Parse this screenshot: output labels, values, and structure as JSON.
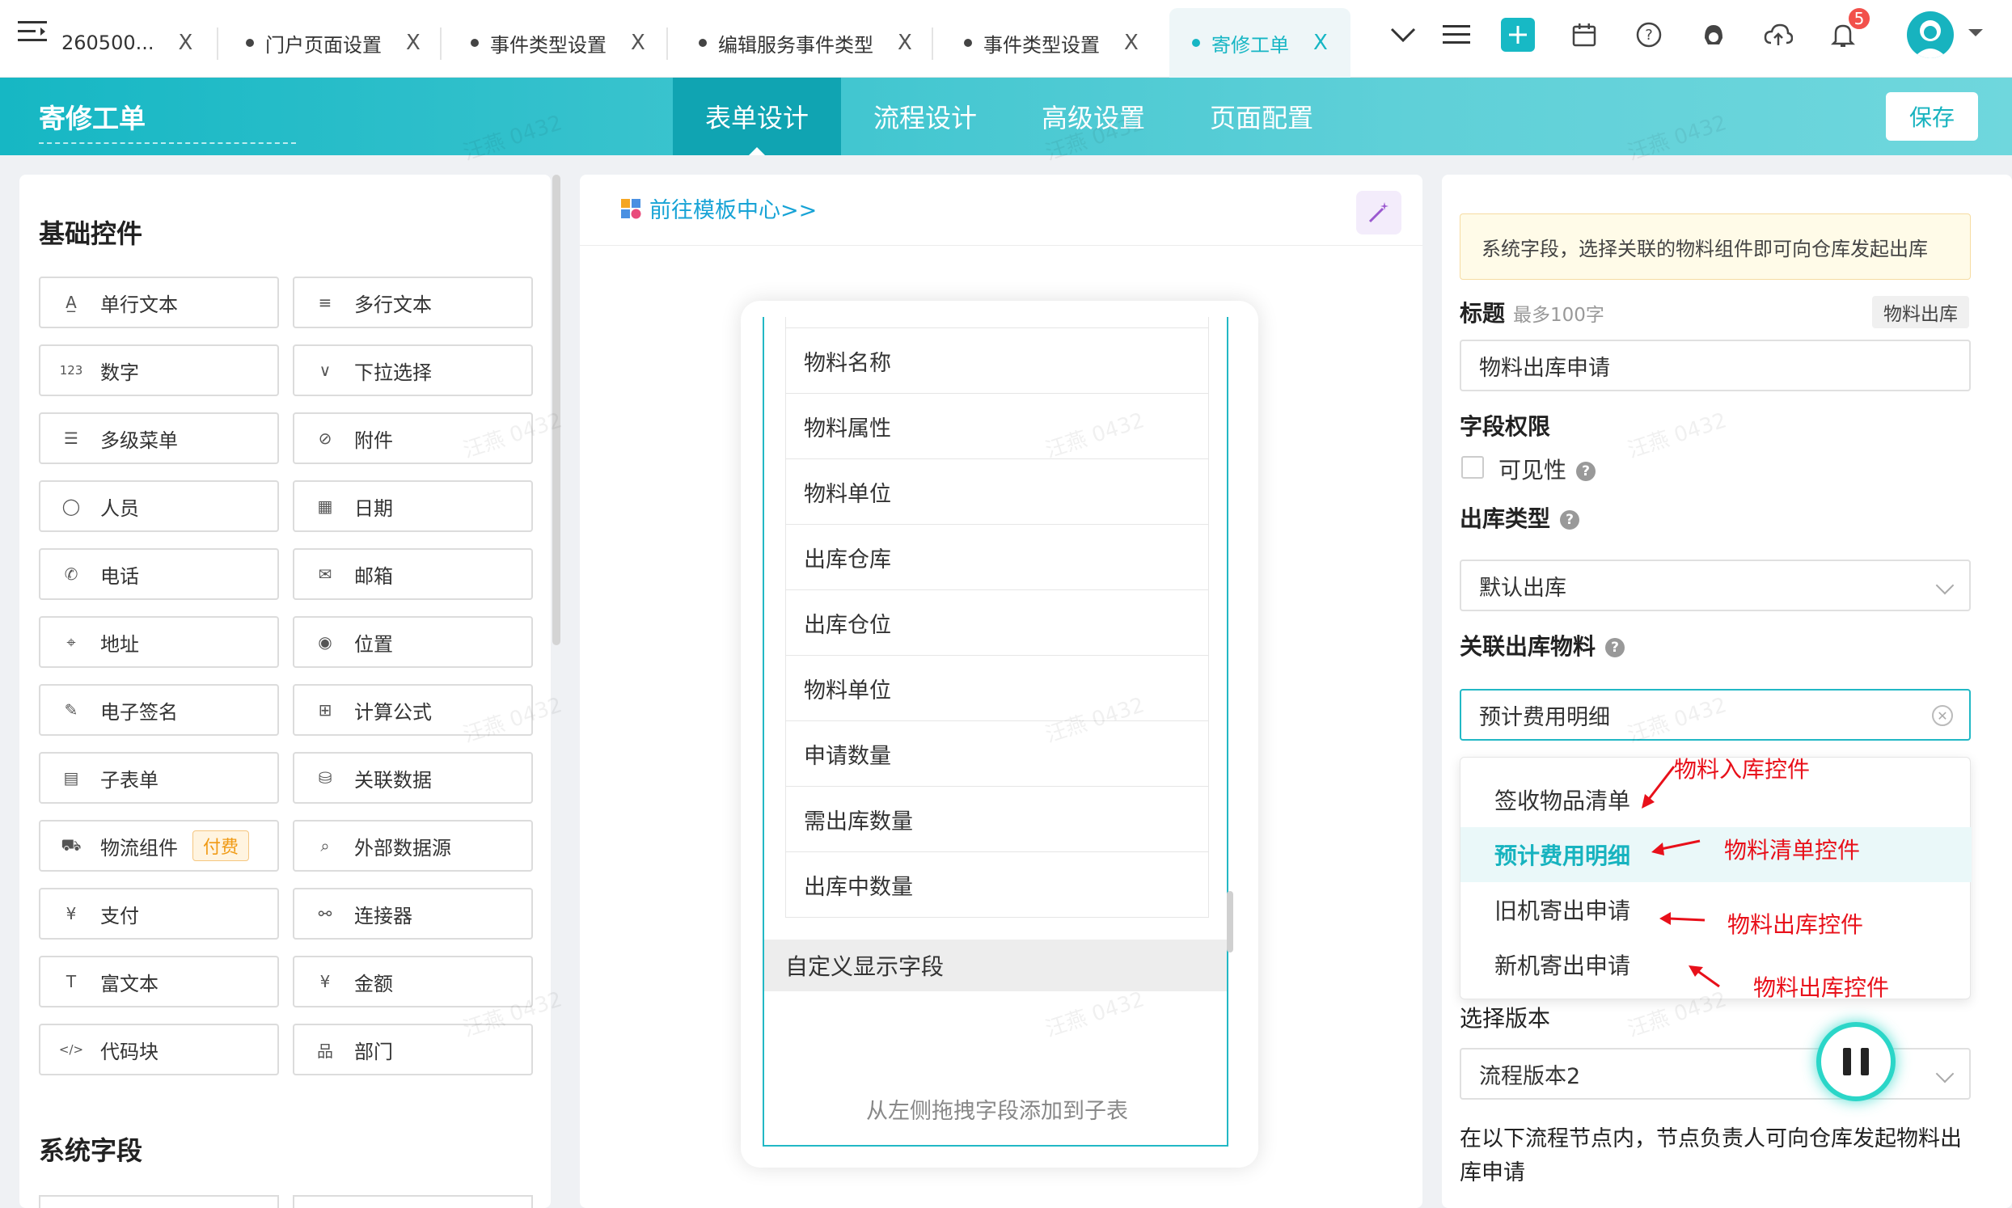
{
  "tabs": [
    {
      "label": "260500...",
      "x": "X"
    },
    {
      "label": "门户页面设置",
      "x": "X"
    },
    {
      "label": "事件类型设置",
      "x": "X"
    },
    {
      "label": "编辑服务事件类型",
      "x": "X"
    },
    {
      "label": "事件类型设置",
      "x": "X"
    },
    {
      "label": "寄修工单",
      "x": "X",
      "active": true
    }
  ],
  "topbar": {
    "notification_count": "5",
    "accent": "#17b9c5"
  },
  "header": {
    "form_title": "寄修工单",
    "tabs": [
      "表单设计",
      "流程设计",
      "高级设置",
      "页面配置"
    ],
    "active_tab": "表单设计",
    "save_label": "保存"
  },
  "left": {
    "basic_title": "基础控件",
    "controls": [
      {
        "label": "单行文本",
        "icon": "single-line-text-icon"
      },
      {
        "label": "多行文本",
        "icon": "multi-line-text-icon"
      },
      {
        "label": "数字",
        "icon": "number-icon"
      },
      {
        "label": "下拉选择",
        "icon": "dropdown-icon"
      },
      {
        "label": "多级菜单",
        "icon": "list-icon"
      },
      {
        "label": "附件",
        "icon": "paperclip-icon"
      },
      {
        "label": "人员",
        "icon": "user-icon"
      },
      {
        "label": "日期",
        "icon": "calendar-icon"
      },
      {
        "label": "电话",
        "icon": "phone-icon"
      },
      {
        "label": "邮箱",
        "icon": "mail-icon"
      },
      {
        "label": "地址",
        "icon": "map-icon"
      },
      {
        "label": "位置",
        "icon": "location-pin-icon"
      },
      {
        "label": "电子签名",
        "icon": "signature-icon"
      },
      {
        "label": "计算公式",
        "icon": "calculator-icon"
      },
      {
        "label": "子表单",
        "icon": "table-icon"
      },
      {
        "label": "关联数据",
        "icon": "database-icon"
      },
      {
        "label": "物流组件",
        "icon": "truck-icon",
        "badge": "付费"
      },
      {
        "label": "外部数据源",
        "icon": "external-data-icon"
      },
      {
        "label": "支付",
        "icon": "yen-circle-icon"
      },
      {
        "label": "连接器",
        "icon": "connector-icon"
      },
      {
        "label": "富文本",
        "icon": "rich-text-icon"
      },
      {
        "label": "金额",
        "icon": "yen-circle-icon"
      },
      {
        "label": "代码块",
        "icon": "code-icon"
      },
      {
        "label": "部门",
        "icon": "org-chart-icon"
      }
    ],
    "system_title": "系统字段"
  },
  "middle": {
    "template_link": "前往模板中心>>",
    "fields": [
      "物料名称",
      "物料属性",
      "物料单位",
      "出库仓库",
      "出库仓位",
      "物料单位",
      "申请数量",
      "需出库数量",
      "出库中数量"
    ],
    "custom_fields": "自定义显示字段",
    "drop_hint": "从左侧拖拽字段添加到子表"
  },
  "right": {
    "tip": "系统字段，选择关联的物料组件即可向仓库发起出库",
    "title_label": "标题",
    "title_hint": "最多100字",
    "title_tag": "物料出库",
    "title_value": "物料出库申请",
    "permission_label": "字段权限",
    "visible_label": "可见性",
    "outbound_type_label": "出库类型",
    "outbound_type_value": "默认出库",
    "linked_label": "关联出库物料",
    "linked_value": "预计费用明细",
    "options": [
      "签收物品清单",
      "预计费用明细",
      "旧机寄出申请",
      "新机寄出申请"
    ],
    "annotations": [
      "物料入库控件",
      "物料清单控件",
      "物料出库控件",
      "物料出库控件"
    ],
    "version_label": "选择版本",
    "version_value": "流程版本2",
    "note": "在以下流程节点内，节点负责人可向仓库发起物料出库申请"
  },
  "watermark": "汪燕 0432"
}
